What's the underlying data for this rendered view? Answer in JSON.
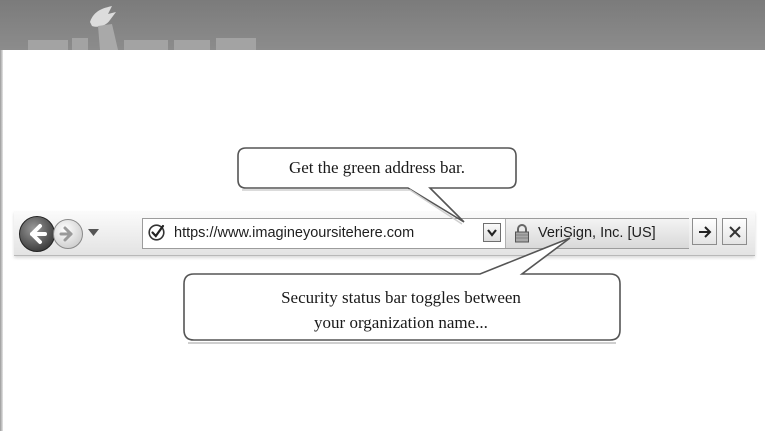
{
  "toolbar": {
    "url": "https://www.imagineyoursitehere.com",
    "organization": "VeriSign, Inc. [US]"
  },
  "callouts": {
    "top": "Get the green address bar.",
    "bottom_line1": "Security status bar toggles  between",
    "bottom_line2": "your organization name..."
  },
  "icons": {
    "back": "back-arrow-icon",
    "forward": "forward-arrow-icon",
    "history": "chevron-down-icon",
    "security_check": "checkmark-circle-icon",
    "lock": "lock-icon",
    "go": "right-arrow-icon",
    "stop": "close-icon"
  },
  "colors": {
    "banner": "#7f7f7f",
    "toolbar": "#ececec",
    "callout_border": "#5a5a5a"
  }
}
